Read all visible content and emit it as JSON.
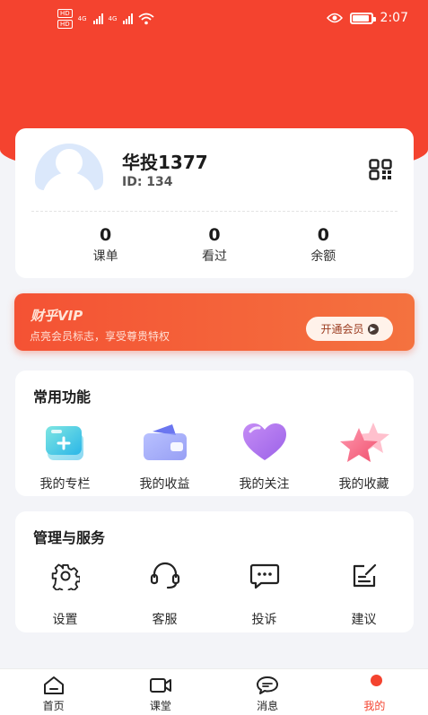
{
  "status_bar": {
    "time": "2:07",
    "sim_tag": "HD",
    "network": "4G"
  },
  "profile": {
    "name": "华投1377",
    "id": "ID: 134"
  },
  "stats": [
    {
      "value": "0",
      "label": "课单"
    },
    {
      "value": "0",
      "label": "看过"
    },
    {
      "value": "0",
      "label": "余额"
    }
  ],
  "vip": {
    "title": "财乎VIP",
    "subtitle": "点亮会员标志，享受尊贵特权",
    "button": "开通会员"
  },
  "functions": {
    "title": "常用功能",
    "items": [
      {
        "label": "我的专栏",
        "icon": "column-icon"
      },
      {
        "label": "我的收益",
        "icon": "wallet-icon"
      },
      {
        "label": "我的关注",
        "icon": "heart-icon"
      },
      {
        "label": "我的收藏",
        "icon": "star-icon"
      }
    ]
  },
  "services": {
    "title": "管理与服务",
    "items": [
      {
        "label": "设置",
        "icon": "gear-icon"
      },
      {
        "label": "客服",
        "icon": "headset-icon"
      },
      {
        "label": "投诉",
        "icon": "chat-bubble-icon"
      },
      {
        "label": "建议",
        "icon": "edit-note-icon"
      }
    ]
  },
  "tabbar": {
    "items": [
      {
        "label": "首页",
        "icon": "home-icon"
      },
      {
        "label": "课堂",
        "icon": "video-camera-icon"
      },
      {
        "label": "消息",
        "icon": "message-icon"
      },
      {
        "label": "我的",
        "icon": "profile-icon",
        "active": true
      }
    ]
  },
  "colors": {
    "accent": "#f4432f",
    "vip_gradient_start": "#f45234",
    "vip_gradient_end": "#f4723f"
  }
}
